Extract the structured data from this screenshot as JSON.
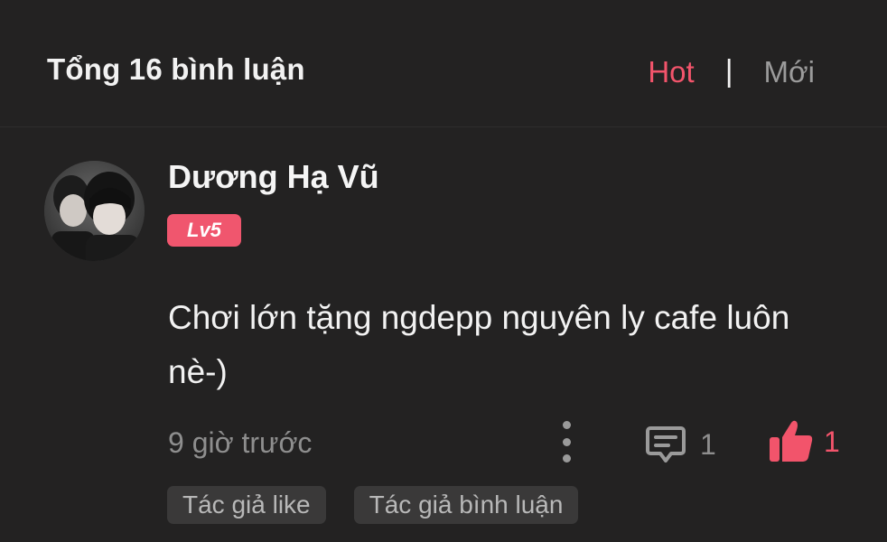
{
  "header": {
    "title": "Tổng 16 bình luận",
    "sort_hot": "Hot",
    "separator": "|",
    "sort_new": "Mới",
    "active_color": "#f2546b"
  },
  "comment": {
    "username": "Dương Hạ Vũ",
    "level": "Lv5",
    "text": "Chơi lớn tặng ngdepp nguyên ly cafe luôn nè-)",
    "timestamp": "9 giờ trước",
    "reply_count": "1",
    "like_count": "1",
    "tags": [
      "Tác giả like",
      "Tác giả bình luận"
    ],
    "icons": {
      "more": "more-vertical-icon",
      "reply": "comment-icon",
      "like": "thumbs-up-icon"
    }
  }
}
